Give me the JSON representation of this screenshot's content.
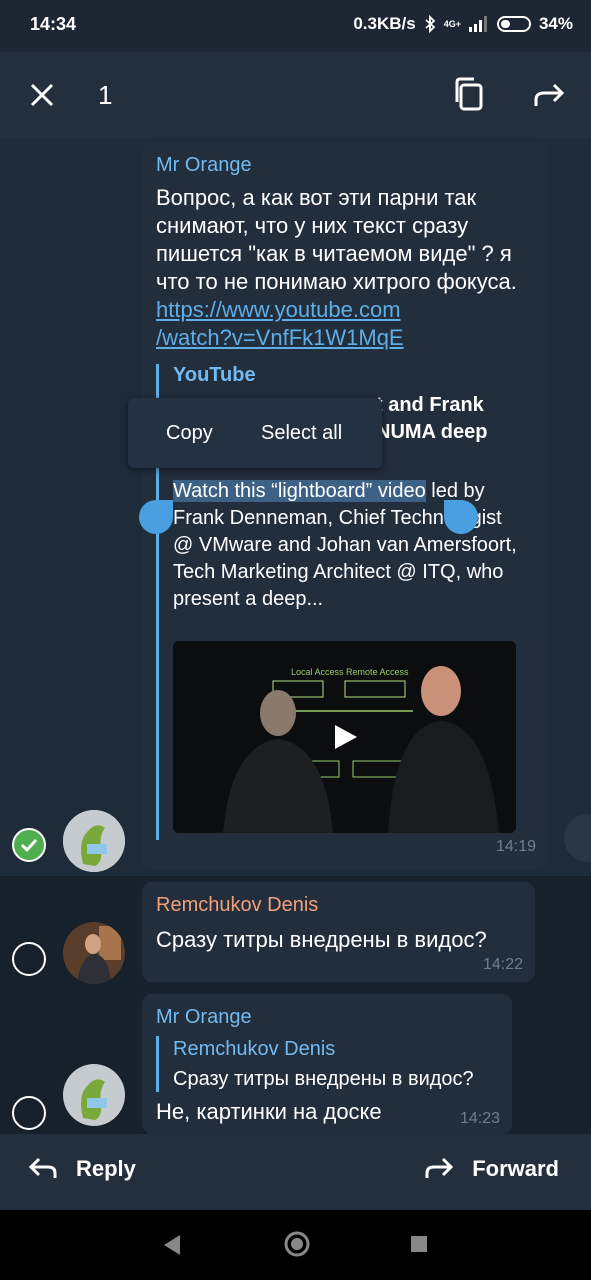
{
  "status": {
    "time": "14:34",
    "speed": "0.3KB/s",
    "network": "4G+",
    "battery": "34%"
  },
  "topbar": {
    "selected_count": "1",
    "close_icon": "close-icon",
    "copy_icon": "copy-icon",
    "forward_icon": "forward-icon"
  },
  "messages": [
    {
      "sender": "Mr Orange",
      "text": "Вопрос, а как вот эти парни так снимают, что у них текст сразу пишется \"как в читаемом виде\" ? я что то не понимаю хитрого фокуса.",
      "link_line1": "https://www.youtube.com",
      "link_line2": "/watch?v=VnfFk1W1MqE",
      "preview": {
        "site": "YouTube",
        "title_line1": "t and Frank",
        "title_line2": "NUMA deep",
        "desc_selected": "Watch this “lightboard” video",
        "desc_rest": "led by Frank Denneman, Chief Technologist @ VMware and Johan van Amersfoort, Tech Marketing Architect @ ITQ, who present a deep..."
      },
      "time": "14:19"
    },
    {
      "sender": "Remchukov Denis",
      "text": "Сразу титры внедрены в видос?",
      "time": "14:22"
    },
    {
      "sender": "Mr Orange",
      "reply_to": "Remchukov Denis",
      "reply_text": "Сразу титры внедрены в видос?",
      "text": "Не, картинки на доске",
      "time": "14:23"
    }
  ],
  "context_menu": {
    "copy": "Copy",
    "select_all": "Select all"
  },
  "bottom": {
    "reply": "Reply",
    "forward": "Forward"
  },
  "colors": {
    "background": "#17212b",
    "bubble": "#232e3c",
    "accent": "#5eaee8",
    "check": "#4fae4e"
  }
}
